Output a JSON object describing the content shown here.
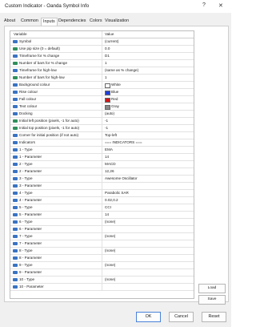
{
  "window": {
    "title": "Custom Indicator - Oanda Symbol Info",
    "help_label": "?",
    "close_label": "✕"
  },
  "tabs": [
    "About",
    "Common",
    "Inputs",
    "Dependencies",
    "Colors",
    "Visualization"
  ],
  "active_tab": "Inputs",
  "table": {
    "headers": {
      "variable": "Variable",
      "value": "Value"
    },
    "rows": [
      {
        "variable": "Symbol",
        "value": "(current)",
        "icon": "abc-icon"
      },
      {
        "variable": "Use pip size (0 = default)",
        "value": "0.0",
        "icon": "number-icon"
      },
      {
        "variable": "Timeframe for % change",
        "value": "D1",
        "icon": "abc-icon"
      },
      {
        "variable": "Number of bars for % change",
        "value": "1",
        "icon": "number-icon"
      },
      {
        "variable": "Timeframe for high-low",
        "value": "(same as % change)",
        "icon": "abc-icon"
      },
      {
        "variable": "Number of bars for high-low",
        "value": "1",
        "icon": "number-icon"
      },
      {
        "variable": "Background colour",
        "value": "White",
        "icon": "abc-icon",
        "swatch": "#ffffff"
      },
      {
        "variable": "Rise colour",
        "value": "Blue",
        "icon": "abc-icon",
        "swatch": "#1f3fd6"
      },
      {
        "variable": "Fall colour",
        "value": "Red",
        "icon": "abc-icon",
        "swatch": "#d01818"
      },
      {
        "variable": "Text colour",
        "value": "Gray",
        "icon": "abc-icon",
        "swatch": "#8a8a8a"
      },
      {
        "variable": "Docking",
        "value": "(auto)",
        "icon": "abc-icon"
      },
      {
        "variable": "Initial left position (pixels, -1 for auto)",
        "value": "-1",
        "icon": "number-icon"
      },
      {
        "variable": "Initial top position (pixels, -1 for auto)",
        "value": "-1",
        "icon": "number-icon"
      },
      {
        "variable": "Corner for initial position (if not auto)",
        "value": "Top-left",
        "icon": "abc-icon"
      },
      {
        "variable": "Indicators",
        "value": "=== INDICATORS ===",
        "icon": "abc-icon"
      },
      {
        "variable": "1 - Type",
        "value": "EMA",
        "icon": "abc-icon"
      },
      {
        "variable": "1 - Parameter",
        "value": "14",
        "icon": "abc-icon"
      },
      {
        "variable": "2 - Type",
        "value": "MACD",
        "icon": "abc-icon"
      },
      {
        "variable": "2 - Parameter",
        "value": "12,26",
        "icon": "abc-icon"
      },
      {
        "variable": "3 - Type",
        "value": "Awesome Oscillator",
        "icon": "abc-icon"
      },
      {
        "variable": "3 - Parameter",
        "value": "",
        "icon": "abc-icon"
      },
      {
        "variable": "4 - Type",
        "value": "Parabolic SAR",
        "icon": "abc-icon"
      },
      {
        "variable": "4 - Parameter",
        "value": "0.02,0.2",
        "icon": "abc-icon"
      },
      {
        "variable": "5 - Type",
        "value": "CCI",
        "icon": "abc-icon"
      },
      {
        "variable": "5 - Parameter",
        "value": "14",
        "icon": "abc-icon"
      },
      {
        "variable": "6 - Type",
        "value": "(none)",
        "icon": "abc-icon"
      },
      {
        "variable": "6 - Parameter",
        "value": "",
        "icon": "abc-icon"
      },
      {
        "variable": "7 - Type",
        "value": "(none)",
        "icon": "abc-icon"
      },
      {
        "variable": "7 - Parameter",
        "value": "",
        "icon": "abc-icon"
      },
      {
        "variable": "8 - Type",
        "value": "(none)",
        "icon": "abc-icon"
      },
      {
        "variable": "8 - Parameter",
        "value": "",
        "icon": "abc-icon"
      },
      {
        "variable": "9 - Type",
        "value": "(none)",
        "icon": "abc-icon"
      },
      {
        "variable": "9 - Parameter",
        "value": "",
        "icon": "abc-icon"
      },
      {
        "variable": "10 - Type",
        "value": "(none)",
        "icon": "abc-icon"
      },
      {
        "variable": "10 - Parameter",
        "value": "",
        "icon": "abc-icon"
      }
    ]
  },
  "buttons": {
    "load": "Load",
    "save": "Save",
    "ok": "OK",
    "cancel": "Cancel",
    "reset": "Reset"
  },
  "colors": {
    "icon_abc": "#3a73c2",
    "icon_number": "#2f8f5b"
  }
}
